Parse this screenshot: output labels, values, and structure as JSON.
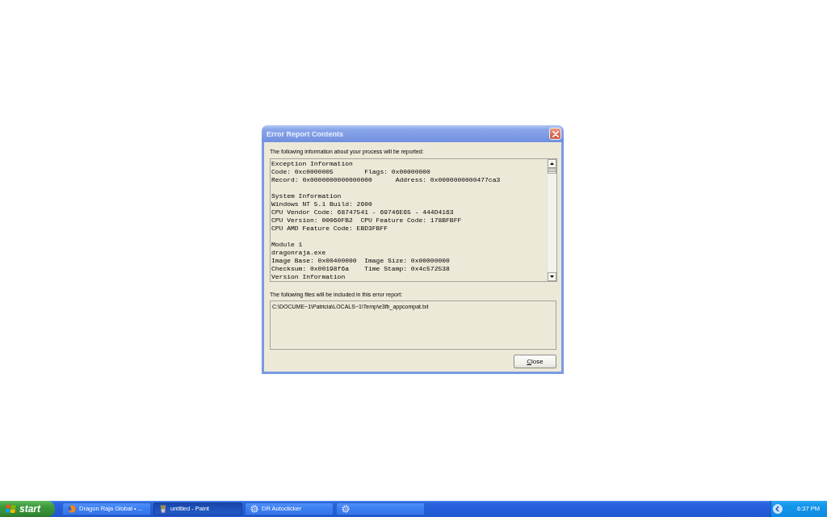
{
  "dialog": {
    "title": "Error Report Contents",
    "report_label": "The following information about your process will be reported:",
    "report_text": {
      "sections": [
        [
          "Exception Information",
          "Code: 0xc0000005        Flags: 0x00000000",
          "Record: 0x0000000000000000      Address: 0x0000000000477ca3"
        ],
        [
          "System Information",
          "Windows NT 5.1 Build: 2600",
          "CPU Vendor Code: 68747541 - 69746E65 - 444D4163",
          "CPU Version: 00060FB2  CPU Feature Code: 178BFBFF",
          "CPU AMD Feature Code: EBD3FBFF"
        ],
        [
          "Module 1",
          "dragonraja.exe",
          "Image Base: 0x00400000  Image Size: 0x00000000",
          "Checksum: 0x00198f6a    Time Stamp: 0x4c572538",
          "Version Information"
        ]
      ]
    },
    "files_label": "The following files will be included in this error report:",
    "files": [
      "C:\\DOCUME~1\\Patricia\\LOCALS~1\\Temp\\e3fb_appcompat.txt"
    ],
    "buttons": [
      {
        "label": "Close"
      }
    ]
  },
  "taskbar": {
    "start_label": "start",
    "tasks": [
      {
        "label": "Dragon Raja Global • ...",
        "kind": "globe",
        "selected": false
      },
      {
        "label": "untitled - Paint",
        "kind": "brush",
        "selected": true
      },
      {
        "label": "DR Autoclicker",
        "kind": "gear",
        "selected": false
      },
      {
        "kind": "gear",
        "selected": false
      }
    ],
    "clock": "6:37 PM"
  }
}
